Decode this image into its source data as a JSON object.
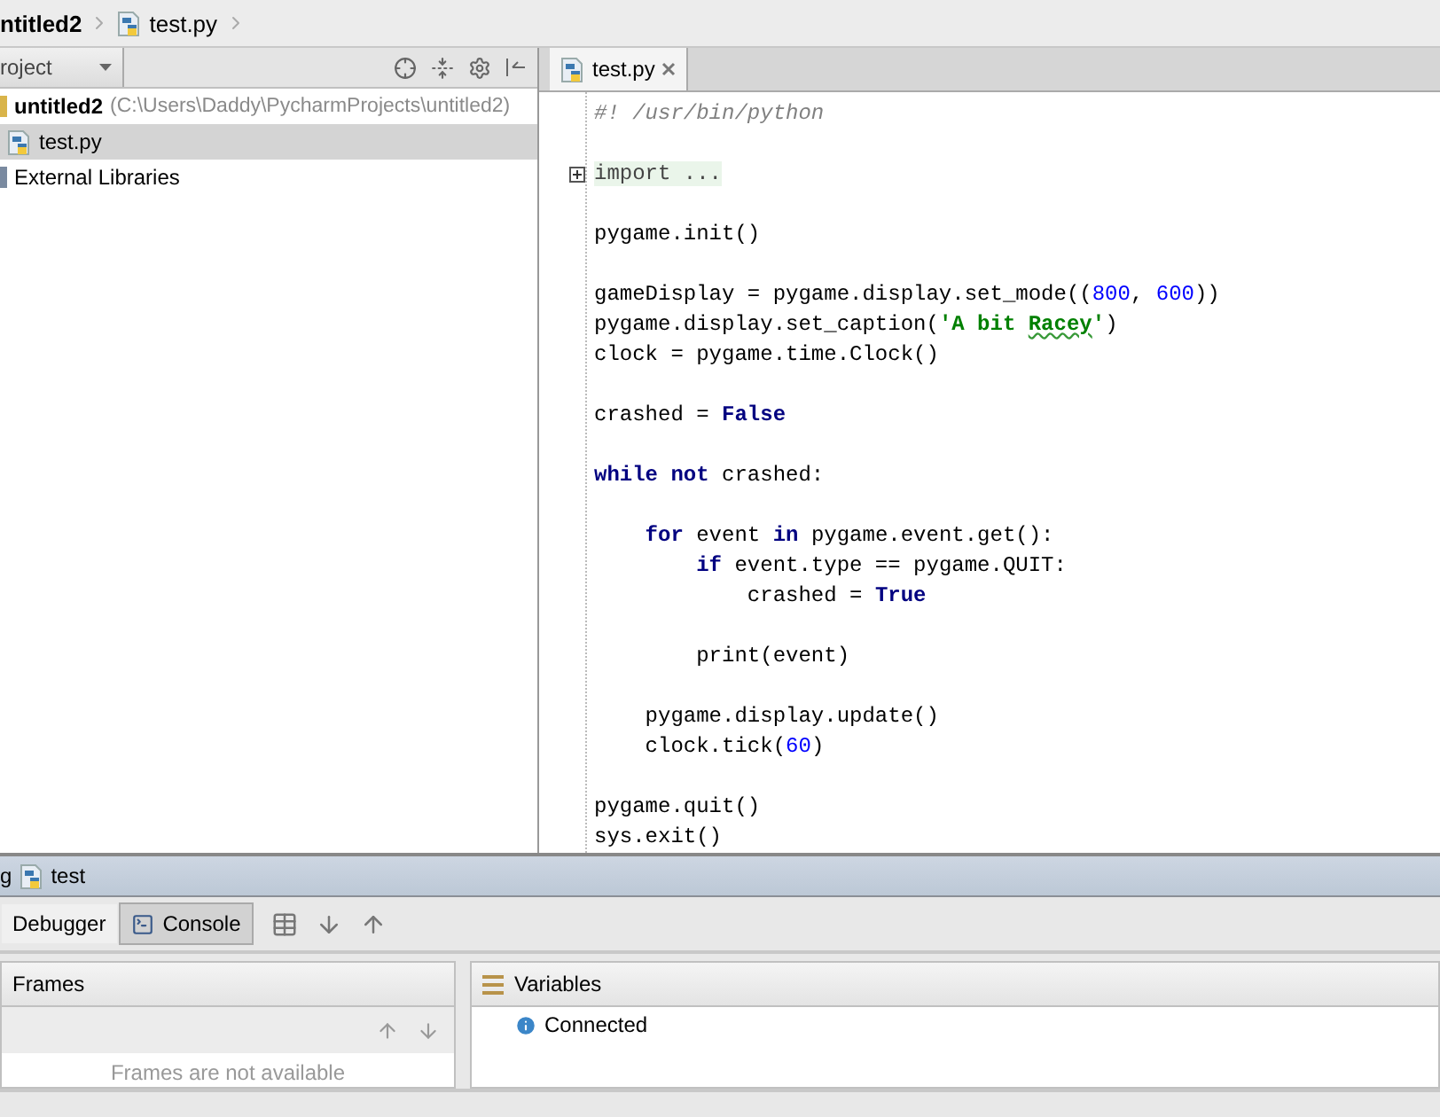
{
  "breadcrumb": [
    {
      "label": "ntitled2",
      "kind": "folder"
    },
    {
      "label": "test.py",
      "kind": "file"
    }
  ],
  "project_panel": {
    "view_selector": "roject",
    "tree": [
      {
        "label": "untitled2",
        "path": "(C:\\Users\\Daddy\\PycharmProjects\\untitled2)",
        "kind": "folder",
        "selected": false,
        "children": [
          {
            "label": "test.py",
            "kind": "file",
            "selected": true
          }
        ]
      },
      {
        "label": "External Libraries",
        "kind": "library",
        "selected": false
      }
    ]
  },
  "editor": {
    "tabs": [
      {
        "label": "test.py",
        "selected": true
      }
    ],
    "lines": [
      {
        "kind": "code",
        "tokens": [
          {
            "kind": "comment",
            "text": "#! /usr/bin/python"
          }
        ]
      },
      {
        "kind": "blank"
      },
      {
        "kind": "code",
        "tokens": [
          {
            "kind": "fold",
            "text": "import ..."
          }
        ]
      },
      {
        "kind": "blank"
      },
      {
        "kind": "code",
        "tokens": [
          {
            "kind": "plain",
            "text": "pygame.init()"
          }
        ]
      },
      {
        "kind": "blank"
      },
      {
        "kind": "code",
        "tokens": [
          {
            "kind": "plain",
            "text": "gameDisplay = pygame.display.set_mode(("
          },
          {
            "kind": "number",
            "text": "800"
          },
          {
            "kind": "plain",
            "text": ", "
          },
          {
            "kind": "number",
            "text": "600"
          },
          {
            "kind": "plain",
            "text": "))"
          }
        ]
      },
      {
        "kind": "code",
        "tokens": [
          {
            "kind": "plain",
            "text": "pygame.display.set_caption("
          },
          {
            "kind": "string",
            "text": "'A bit "
          },
          {
            "kind": "typo",
            "text": "Racey"
          },
          {
            "kind": "string",
            "text": "'"
          },
          {
            "kind": "plain",
            "text": ")"
          }
        ]
      },
      {
        "kind": "code",
        "tokens": [
          {
            "kind": "plain",
            "text": "clock = pygame.time.Clock()"
          }
        ]
      },
      {
        "kind": "blank"
      },
      {
        "kind": "code",
        "tokens": [
          {
            "kind": "plain",
            "text": "crashed = "
          },
          {
            "kind": "keyword",
            "text": "False"
          }
        ]
      },
      {
        "kind": "blank"
      },
      {
        "kind": "code",
        "tokens": [
          {
            "kind": "keyword",
            "text": "while not "
          },
          {
            "kind": "plain",
            "text": "crashed:"
          }
        ]
      },
      {
        "kind": "blank"
      },
      {
        "kind": "code",
        "tokens": [
          {
            "kind": "keyword",
            "text": "    for "
          },
          {
            "kind": "plain",
            "text": "event "
          },
          {
            "kind": "keyword",
            "text": "in "
          },
          {
            "kind": "plain",
            "text": "pygame.event.get():"
          }
        ]
      },
      {
        "kind": "code",
        "tokens": [
          {
            "kind": "keyword",
            "text": "        if "
          },
          {
            "kind": "plain",
            "text": "event.type == pygame.QUIT:"
          }
        ]
      },
      {
        "kind": "code",
        "tokens": [
          {
            "kind": "plain",
            "text": "            crashed = "
          },
          {
            "kind": "keyword",
            "text": "True"
          }
        ]
      },
      {
        "kind": "blank"
      },
      {
        "kind": "code",
        "tokens": [
          {
            "kind": "plain",
            "text": "        print(event)"
          }
        ]
      },
      {
        "kind": "blank"
      },
      {
        "kind": "code",
        "tokens": [
          {
            "kind": "plain",
            "text": "    pygame.display.update()"
          }
        ]
      },
      {
        "kind": "code",
        "tokens": [
          {
            "kind": "plain",
            "text": "    clock.tick("
          },
          {
            "kind": "number",
            "text": "60"
          },
          {
            "kind": "plain",
            "text": ")"
          }
        ]
      },
      {
        "kind": "blank"
      },
      {
        "kind": "code",
        "tokens": [
          {
            "kind": "plain",
            "text": "pygame.quit()"
          }
        ]
      },
      {
        "kind": "code",
        "tokens": [
          {
            "kind": "plain",
            "text": "sys.exit()"
          }
        ]
      }
    ]
  },
  "debug": {
    "title_prefix": "g",
    "config": "test",
    "tabs": [
      {
        "label": "Debugger",
        "selected": true
      },
      {
        "label": "Console",
        "selected": false
      }
    ],
    "frames": {
      "title": "Frames",
      "empty_text": "Frames are not available"
    },
    "variables": {
      "title": "Variables",
      "items": [
        "Connected"
      ]
    }
  }
}
